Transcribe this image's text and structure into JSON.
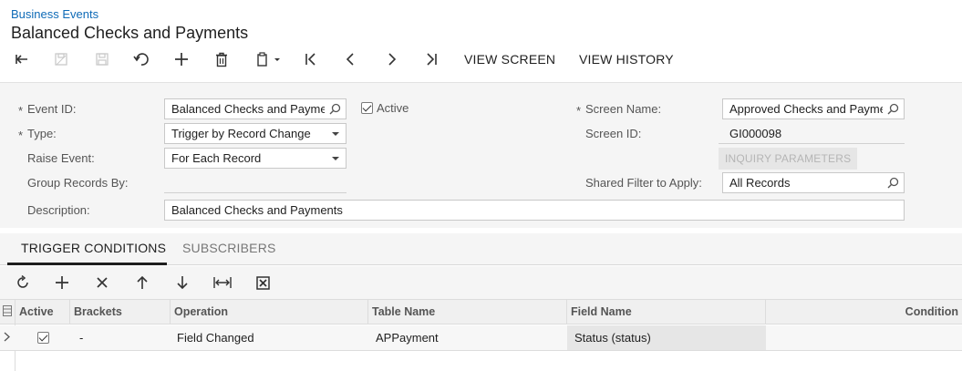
{
  "header": {
    "breadcrumb": "Business Events",
    "title": "Balanced Checks and Payments"
  },
  "toolbar": {
    "icons": [
      "back-icon",
      "save-close-icon",
      "save-icon",
      "undo-icon",
      "add-icon",
      "delete-icon",
      "copy-paste-icon",
      "first-record-icon",
      "previous-record-icon",
      "next-record-icon",
      "last-record-icon"
    ],
    "view_screen": "VIEW SCREEN",
    "view_history": "VIEW HISTORY"
  },
  "form": {
    "event_id_label": "Event ID:",
    "event_id_value": "Balanced Checks and Payments",
    "active_label": "Active",
    "active_checked": true,
    "type_label": "Type:",
    "type_value": "Trigger by Record Change",
    "raise_event_label": "Raise Event:",
    "raise_event_value": "For Each Record",
    "group_records_label": "Group Records By:",
    "group_records_value": "",
    "description_label": "Description:",
    "description_value": "Balanced Checks and Payments",
    "screen_name_label": "Screen Name:",
    "screen_name_value": "Approved Checks and Payments",
    "screen_id_label": "Screen ID:",
    "screen_id_value": "GI000098",
    "inquiry_params_label": "INQUIRY PARAMETERS",
    "shared_filter_label": "Shared Filter to Apply:",
    "shared_filter_value": "All Records",
    "required_mark": "*"
  },
  "tabs": [
    {
      "label": "TRIGGER CONDITIONS",
      "active": true
    },
    {
      "label": "SUBSCRIBERS",
      "active": false
    }
  ],
  "grid_toolbar": {
    "icons": [
      "refresh-icon",
      "add-row-icon",
      "delete-row-icon",
      "move-up-icon",
      "move-down-icon",
      "fit-columns-icon",
      "export-excel-icon"
    ]
  },
  "grid": {
    "columns": [
      "Active",
      "Brackets",
      "Operation",
      "Table Name",
      "Field Name",
      "Condition"
    ],
    "rows": [
      {
        "active": true,
        "brackets": "-",
        "operation": "Field Changed",
        "table_name": "APPayment",
        "field_name": "Status (status)",
        "condition": ""
      }
    ]
  },
  "colors": {
    "link": "#0f6bb7",
    "form_bg": "#f5f5f5",
    "text": "#1f1f1f"
  }
}
